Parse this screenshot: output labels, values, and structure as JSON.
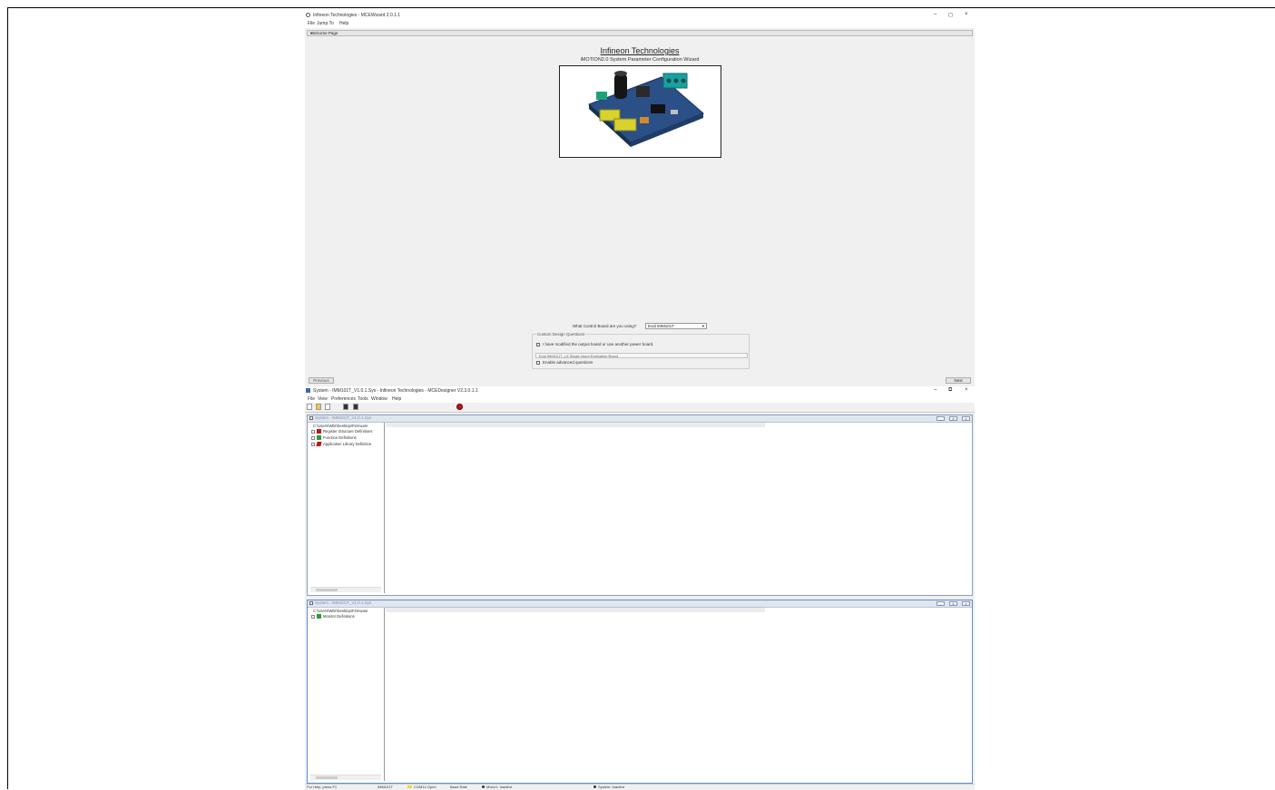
{
  "wizard": {
    "title": "Infineon Technologies - MCEWizard 2.0.1.1",
    "menu": [
      "File",
      "Jump To",
      "Help"
    ],
    "page_selector": "Welcome Page",
    "company": "Infineon Technologies",
    "subtitle": "iMOTION2.0 System Parameter Configuration Wizard",
    "board_question": "What Control Board are you using?",
    "board_value": "Eval IMM101T",
    "group_title": "Custom Design Questions",
    "checkbox_modified": "I have modified the output board or use another power board.",
    "power_board_value": "Eval IMM101T_L5 Single shunt Evaluation Board",
    "checkbox_advanced": "Enable advanced questions",
    "previous_label": "Previous",
    "next_label": "Next"
  },
  "designer": {
    "title": "System - IMM101T_V1.0.1.Sys - Infineon Technologies - MCEDesigner V2.3.0.1.1",
    "menu": [
      "File",
      "View",
      "Preferences",
      "Tools",
      "Window",
      "Help"
    ],
    "panel1": {
      "title": "System - IMM101T_V1.0.1.Sys",
      "path": "C:\\Users\\Wiki\\Desktop\\Firmware",
      "nodes": [
        "Register Structure Definitions",
        "Function Definitions",
        "Application Library Definition"
      ]
    },
    "panel2": {
      "title": "System - IMM101T_V1.0.1.Sys",
      "path": "C:\\Users\\Wiki\\Desktop\\Firmware",
      "nodes": [
        "Monitor Definitions"
      ]
    },
    "panel_controls": [
      "_",
      "#",
      "x"
    ],
    "status": [
      "For Help, press F1",
      "IMM101T",
      "COM14 Open",
      "Baud Rate",
      "Motor1: Inactive",
      "System: Inactive"
    ]
  },
  "colors": {
    "accent_red": "#c0161b",
    "pcb_blue": "#2b4f87",
    "panel_border": "#8aa0c0"
  }
}
